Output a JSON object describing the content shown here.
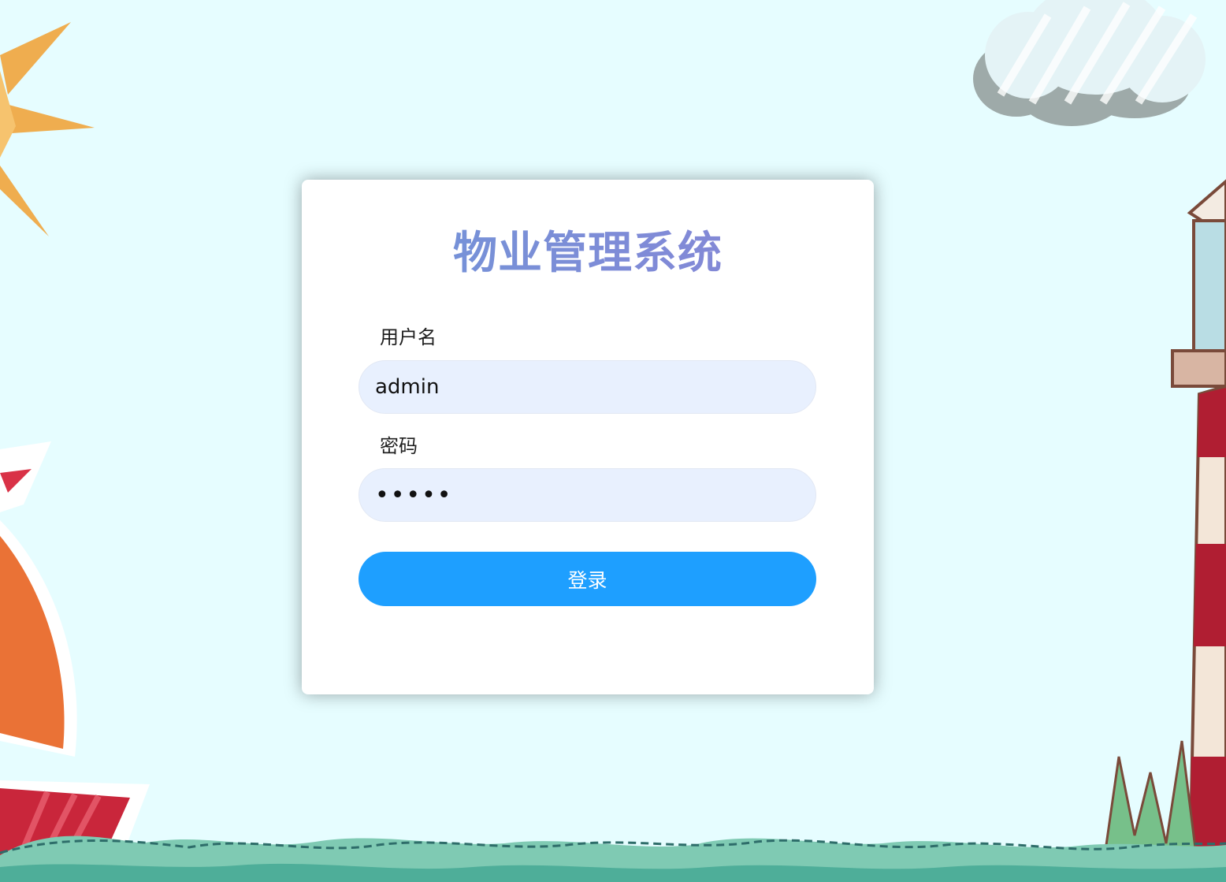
{
  "app": {
    "title": "物业管理系统"
  },
  "form": {
    "username_label": "用户名",
    "username_value": "admin",
    "password_label": "密码",
    "password_value": "•••••",
    "login_button": "登录"
  },
  "colors": {
    "background": "#e6fdff",
    "card": "#ffffff",
    "title": "#7d8fd6",
    "input_fill": "#e8f0fe",
    "button": "#1e9fff",
    "sail_orange": "#ea7236",
    "boat_red": "#c9263b",
    "wave": "#7fcab3",
    "cloud": "#9eaaa9",
    "sun": "#f0a43c",
    "lighthouse_red": "#b01e32"
  },
  "decorations": [
    "sun-illustration",
    "cloud-illustration",
    "sailboat-illustration",
    "lighthouse-illustration",
    "sea-waves-illustration"
  ]
}
